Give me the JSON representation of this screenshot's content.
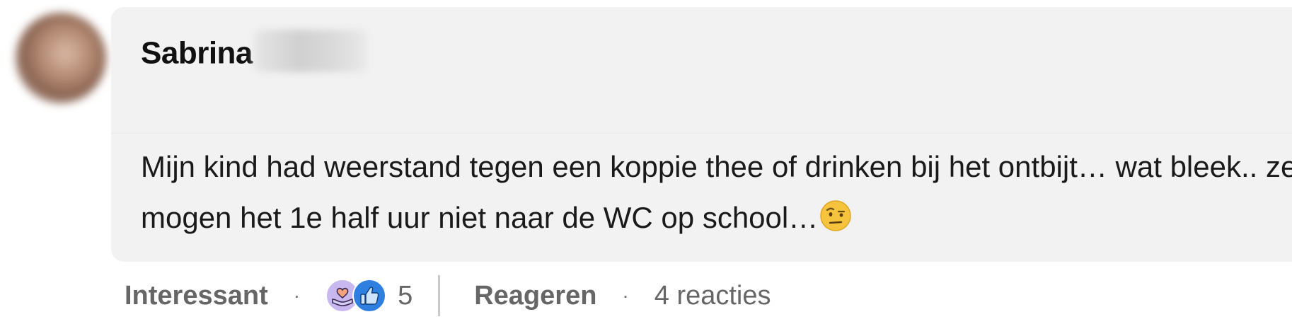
{
  "comment": {
    "author_name": "Sabrina",
    "text": "Mijn kind had weerstand tegen een koppie thee of drinken bij het ontbijt… wat bleek.. ze mogen het 1e half uur niet naar de WC op school…",
    "emoji": "raised-eyebrow-face-emoji"
  },
  "actions": {
    "like_label": "Interessant",
    "reaction_count": "5",
    "reaction_icons": [
      "support-heart-hand-icon",
      "like-thumbs-up-icon"
    ],
    "reply_label": "Reageren",
    "replies_count_label": "4 reacties",
    "separator": "·"
  },
  "colors": {
    "bubble_bg": "#f2f2f2",
    "like_blue": "#2f7fe0",
    "support_purple": "#b9a6e6"
  }
}
